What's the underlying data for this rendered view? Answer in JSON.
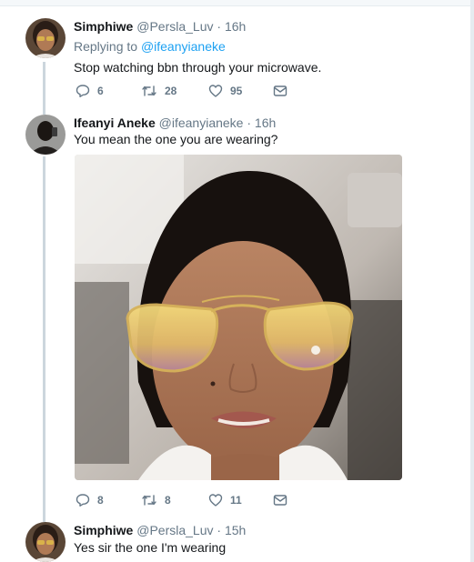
{
  "tweets": [
    {
      "name": "Simphiwe",
      "handle": "@Persla_Luv",
      "separator": "·",
      "time": "16h",
      "replying_prefix": "Replying to",
      "replying_to": "@ifeanyianeke",
      "text": "Stop watching bbn through your microwave.",
      "replies": "6",
      "retweets": "28",
      "likes": "95",
      "avatar_icon": "avatar-woman-sunglasses"
    },
    {
      "name": "Ifeanyi Aneke",
      "handle": "@ifeanyianeke",
      "separator": "·",
      "time": "16h",
      "text": "You mean the one you are wearing?",
      "replies": "8",
      "retweets": "8",
      "likes": "11",
      "avatar_icon": "avatar-man-dark",
      "photo_icon": "selfie-woman-tinted-sunglasses"
    },
    {
      "name": "Simphiwe",
      "handle": "@Persla_Luv",
      "separator": "·",
      "time": "15h",
      "text": "Yes sir the one I'm wearing",
      "avatar_icon": "avatar-woman-sunglasses"
    }
  ],
  "icons": {
    "reply": "reply-icon",
    "retweet": "retweet-icon",
    "like": "heart-icon",
    "dm": "envelope-icon"
  },
  "colors": {
    "name": "#14171a",
    "muted": "#657786",
    "link": "#1da1f2",
    "thread": "#ccd6dd"
  }
}
